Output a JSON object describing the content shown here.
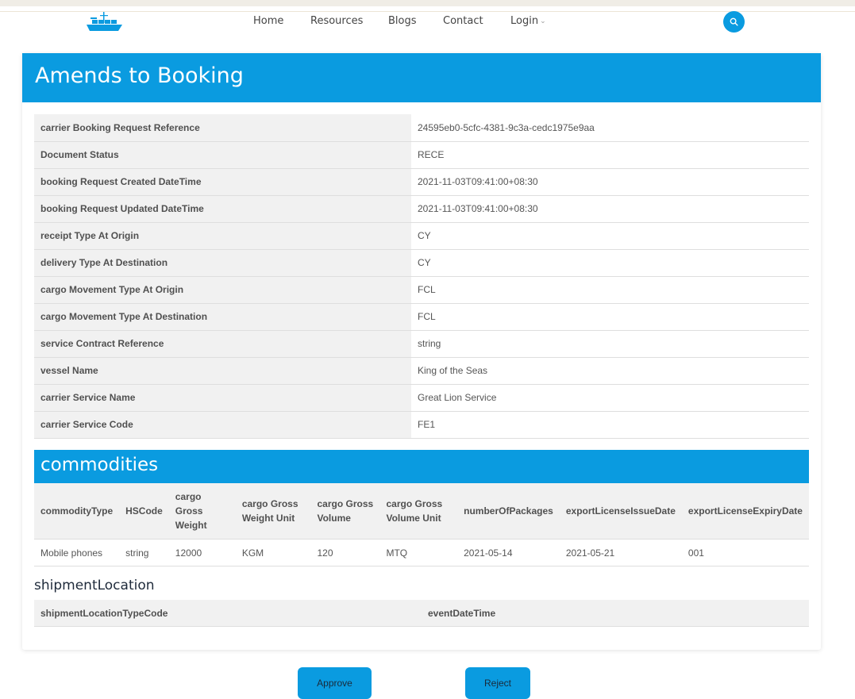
{
  "nav": {
    "items": [
      {
        "label": "Home"
      },
      {
        "label": "Resources"
      },
      {
        "label": "Blogs"
      },
      {
        "label": "Contact"
      },
      {
        "label": "Login"
      }
    ],
    "search_icon": "search-icon",
    "logo_icon": "ship-logo-icon"
  },
  "colors": {
    "accent": "#0a9be0"
  },
  "page": {
    "title": "Amends to Booking"
  },
  "booking": {
    "fields": [
      {
        "key": "carrier Booking Request Reference",
        "value": "24595eb0-5cfc-4381-9c3a-cedc1975e9aa"
      },
      {
        "key": "Document Status",
        "value": "RECE"
      },
      {
        "key": "booking Request Created DateTime",
        "value": "2021-11-03T09:41:00+08:30"
      },
      {
        "key": "booking Request Updated DateTime",
        "value": "2021-11-03T09:41:00+08:30"
      },
      {
        "key": "receipt Type At Origin",
        "value": "CY"
      },
      {
        "key": "delivery Type At Destination",
        "value": "CY"
      },
      {
        "key": "cargo Movement Type At Origin",
        "value": "FCL"
      },
      {
        "key": "cargo Movement Type At Destination",
        "value": "FCL"
      },
      {
        "key": "service Contract Reference",
        "value": "string"
      },
      {
        "key": "vessel Name",
        "value": "King of the Seas"
      },
      {
        "key": "carrier Service Name",
        "value": "Great Lion Service"
      },
      {
        "key": "carrier Service Code",
        "value": "FE1"
      }
    ]
  },
  "commodities": {
    "title": "commodities",
    "columns": [
      "commodityType",
      "HSCode",
      "cargo Gross Weight",
      "cargo Gross Weight Unit",
      "cargo Gross Volume",
      "cargo Gross Volume Unit",
      "numberOfPackages",
      "exportLicenseIssueDate",
      "exportLicenseExpiryDate"
    ],
    "rows": [
      [
        "Mobile phones",
        "string",
        "12000",
        "KGM",
        "120",
        "MTQ",
        "2021-05-14",
        "2021-05-21",
        "001"
      ]
    ]
  },
  "shipmentLocation": {
    "title": "shipmentLocation",
    "columns": [
      "shipmentLocationTypeCode",
      "eventDateTime"
    ]
  },
  "actions": {
    "approve": "Approve",
    "reject": "Reject"
  }
}
